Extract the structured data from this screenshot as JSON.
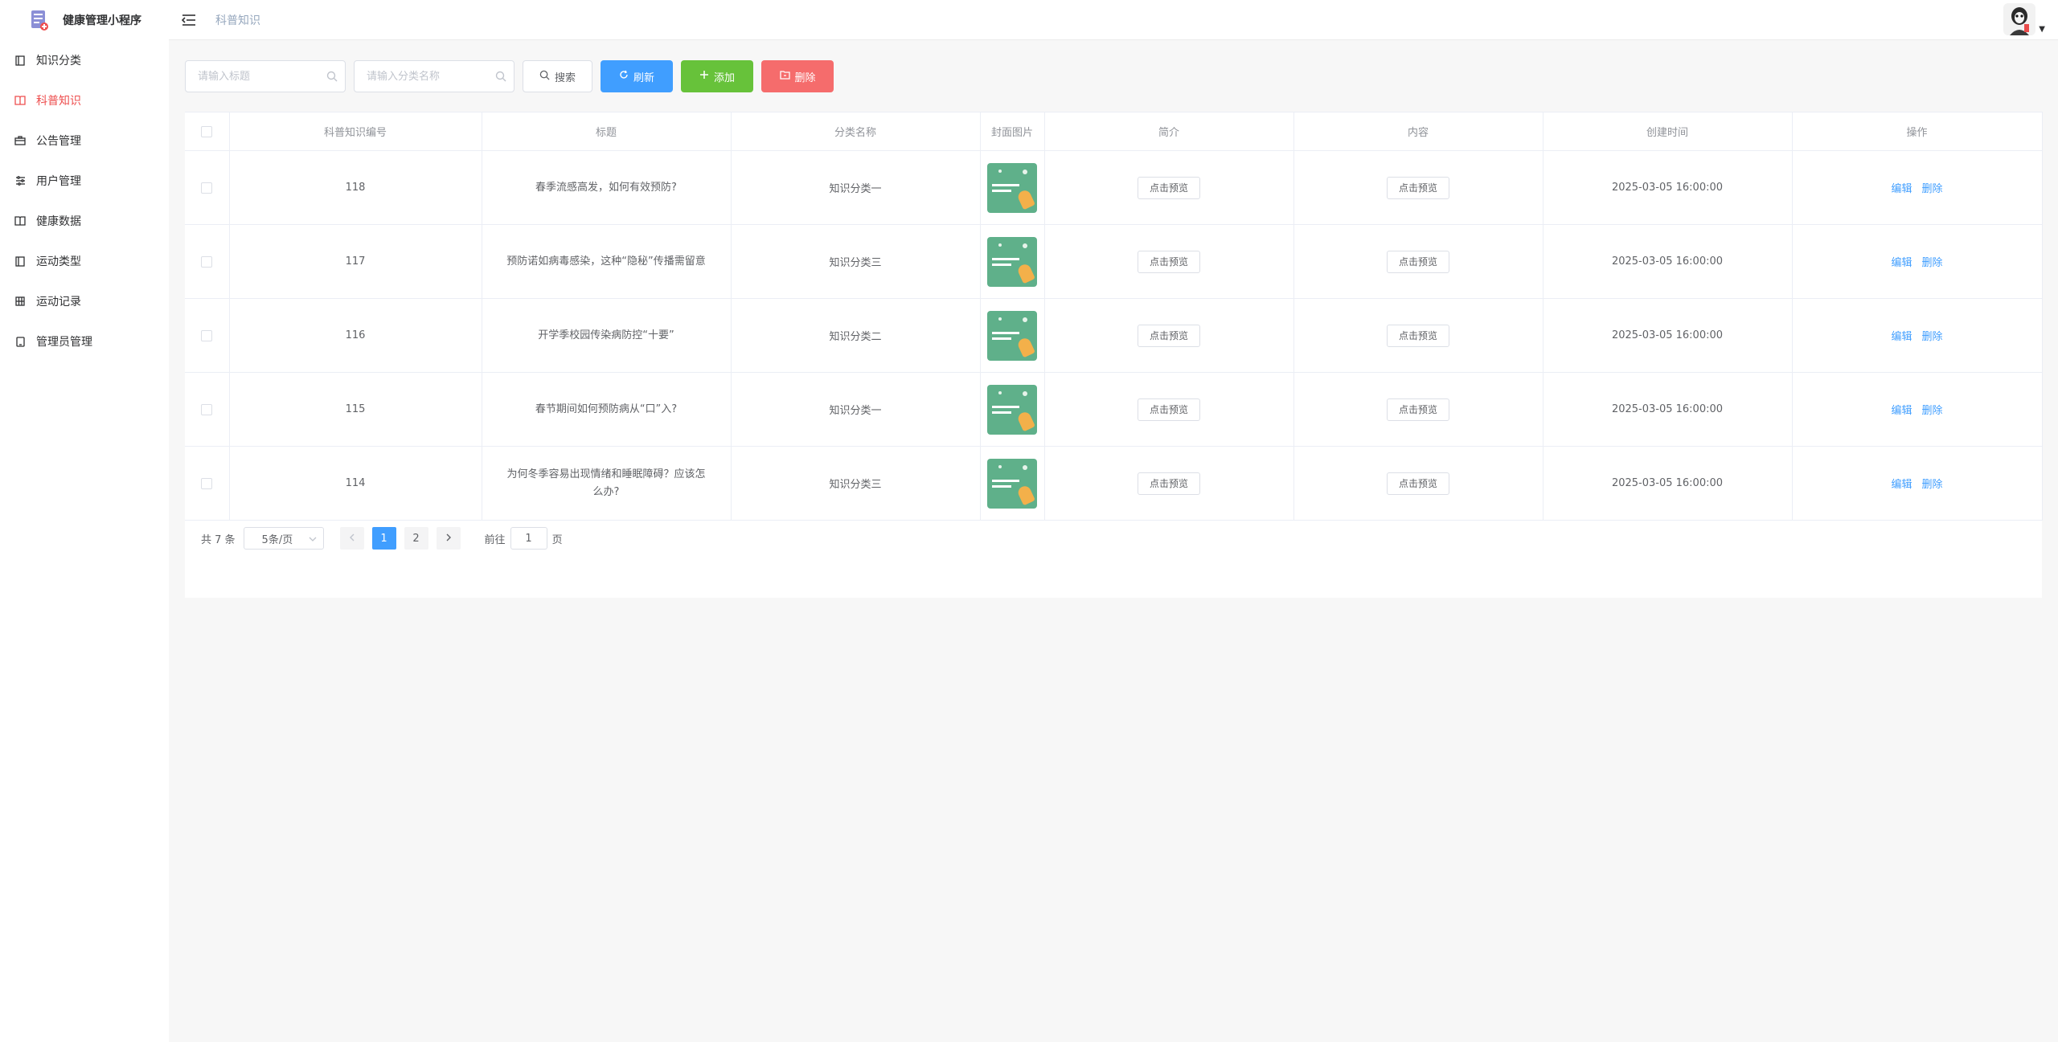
{
  "brand": {
    "title": "健康管理小程序"
  },
  "sidebar": {
    "items": [
      {
        "label": "知识分类",
        "icon": "book-icon",
        "active": false
      },
      {
        "label": "科普知识",
        "icon": "open-book-icon",
        "active": true
      },
      {
        "label": "公告管理",
        "icon": "briefcase-icon",
        "active": false
      },
      {
        "label": "用户管理",
        "icon": "sliders-icon",
        "active": false
      },
      {
        "label": "健康数据",
        "icon": "open-book-icon",
        "active": false
      },
      {
        "label": "运动类型",
        "icon": "book-icon",
        "active": false
      },
      {
        "label": "运动记录",
        "icon": "grid-icon",
        "active": false
      },
      {
        "label": "管理员管理",
        "icon": "tablet-icon",
        "active": false
      }
    ]
  },
  "header": {
    "breadcrumb": "科普知识"
  },
  "toolbar": {
    "title_placeholder": "请输入标题",
    "category_placeholder": "请输入分类名称",
    "search_label": "搜索",
    "refresh_label": "刷新",
    "add_label": "添加",
    "delete_label": "删除"
  },
  "table": {
    "columns": [
      "科普知识编号",
      "标题",
      "分类名称",
      "封面图片",
      "简介",
      "内容",
      "创建时间",
      "操作"
    ],
    "preview_label": "点击预览",
    "edit_label": "编辑",
    "delete_label": "删除",
    "rows": [
      {
        "id": "118",
        "title": "春季流感高发，如何有效预防?",
        "category": "知识分类一",
        "created": "2025-03-05 16:00:00"
      },
      {
        "id": "117",
        "title": "预防诺如病毒感染，这种“隐秘”传播需留意",
        "category": "知识分类三",
        "created": "2025-03-05 16:00:00"
      },
      {
        "id": "116",
        "title": "开学季校园传染病防控“十要”",
        "category": "知识分类二",
        "created": "2025-03-05 16:00:00"
      },
      {
        "id": "115",
        "title": "春节期间如何预防病从“口”入?",
        "category": "知识分类一",
        "created": "2025-03-05 16:00:00"
      },
      {
        "id": "114",
        "title": "为何冬季容易出现情绪和睡眠障碍？应该怎么办?",
        "category": "知识分类三",
        "created": "2025-03-05 16:00:00"
      }
    ]
  },
  "pagination": {
    "total_text": "共 7 条",
    "page_size": "5条/页",
    "pages": [
      "1",
      "2"
    ],
    "current": "1",
    "goto_prefix": "前往",
    "goto_value": "1",
    "goto_suffix": "页"
  },
  "colors": {
    "accent": "#409eff",
    "success": "#67c23a",
    "danger": "#f56c6c",
    "active_menu": "#ee4f4f"
  }
}
